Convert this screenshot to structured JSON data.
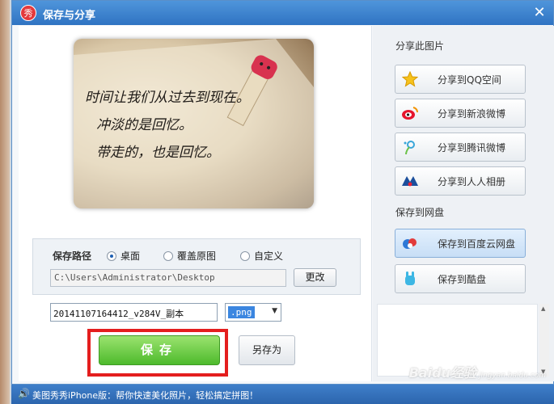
{
  "window": {
    "title": "保存与分享",
    "logo_char": "秀"
  },
  "photo": {
    "handwriting": [
      "时间让我们从过去到现在。",
      "冲淡的是回忆。",
      "带走的，也是回忆。"
    ]
  },
  "save_path": {
    "label": "保存路径",
    "options": [
      {
        "label": "桌面",
        "selected": true
      },
      {
        "label": "覆盖原图",
        "selected": false
      },
      {
        "label": "自定义",
        "selected": false
      }
    ],
    "path": "C:\\Users\\Administrator\\Desktop",
    "change_label": "更改"
  },
  "file": {
    "name": "20141107164412_v284V_副本",
    "ext": ".png"
  },
  "actions": {
    "save_label": "保存",
    "save_as_label": "另存为"
  },
  "share": {
    "section_title": "分享此图片",
    "items": [
      {
        "label": "分享到QQ空间",
        "icon": "star-icon"
      },
      {
        "label": "分享到新浪微博",
        "icon": "weibo-icon"
      },
      {
        "label": "分享到腾讯微博",
        "icon": "tencent-weibo-icon"
      },
      {
        "label": "分享到人人相册",
        "icon": "renren-icon"
      }
    ]
  },
  "cloud": {
    "section_title": "保存到网盘",
    "items": [
      {
        "label": "保存到百度云网盘",
        "icon": "baidu-cloud-icon"
      },
      {
        "label": "保存到酷盘",
        "icon": "kupan-icon"
      }
    ]
  },
  "statusbar": {
    "text": "美图秀秀iPhone版：帮你快速美化照片，轻松搞定拼图！"
  },
  "watermark": {
    "brand": "Baidu经验",
    "url": "jingyan.baidu.com"
  },
  "colors": {
    "title_bar": "#2f73c2",
    "save_green": "#4dba2c",
    "highlight_red": "#e41e1e"
  }
}
